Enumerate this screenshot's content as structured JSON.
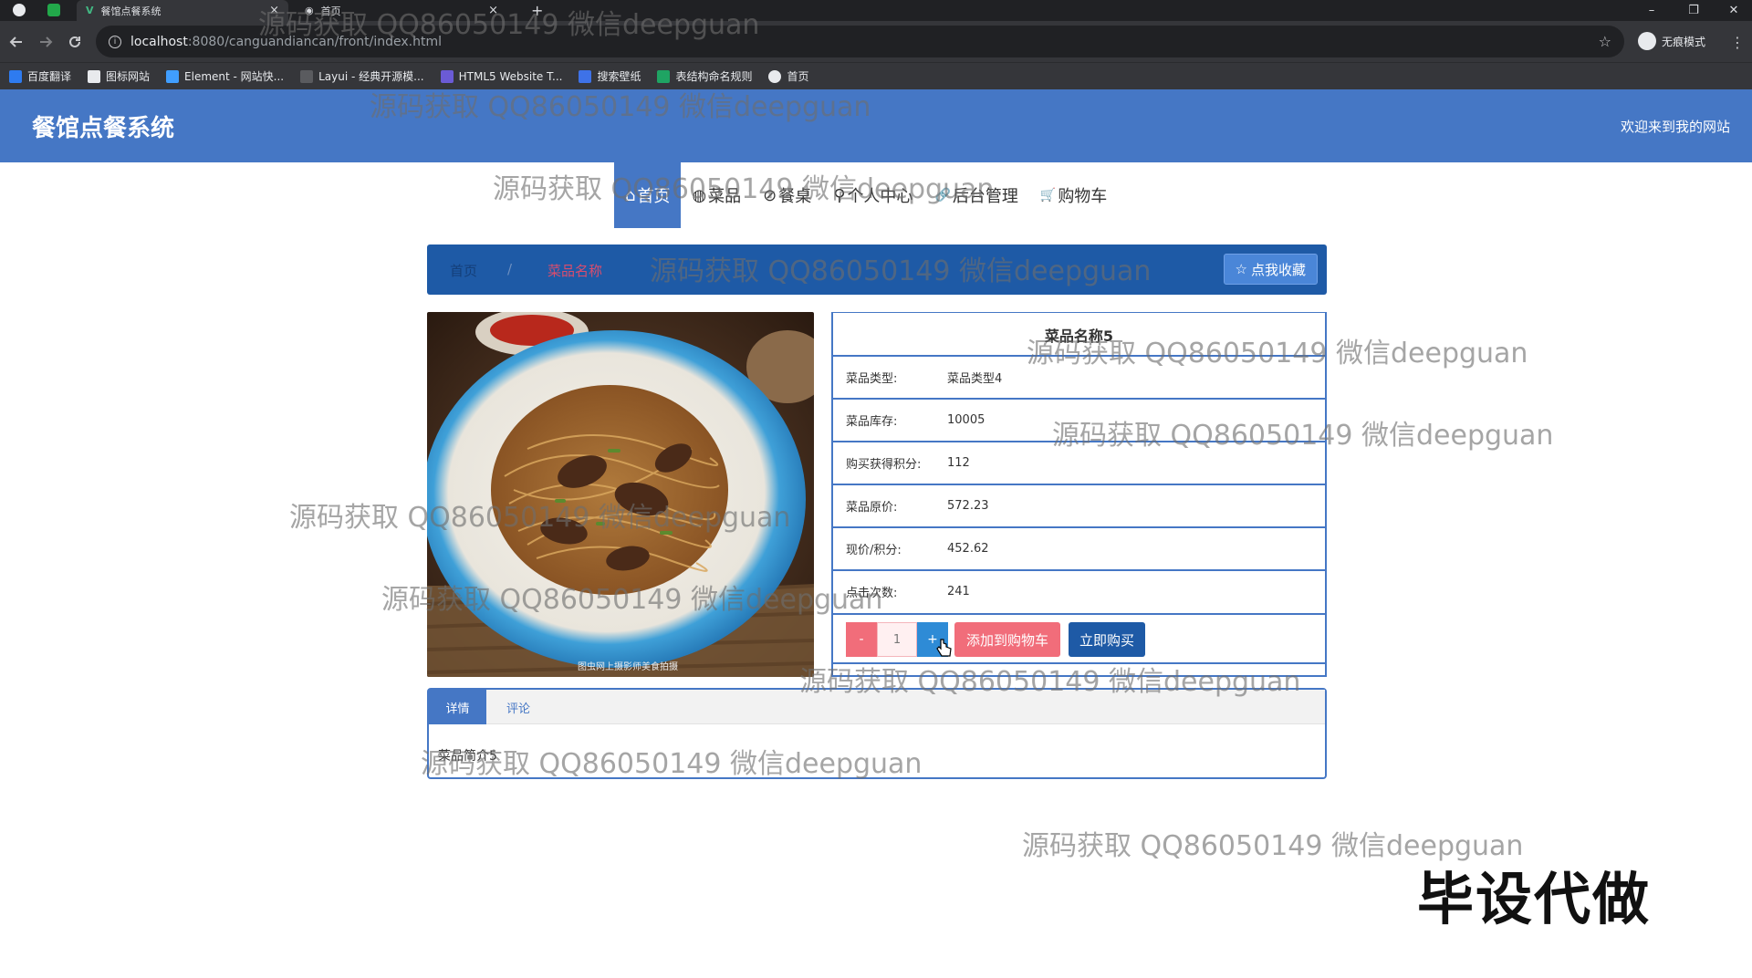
{
  "browser": {
    "tabs": [
      {
        "title": "餐馆点餐系统",
        "close": "×"
      },
      {
        "title": "首页",
        "close": "×"
      }
    ],
    "new_tab": "+",
    "window_controls": {
      "minimize": "–",
      "restore": "❐",
      "close": "✕"
    },
    "url_host": "localhost",
    "url_path": ":8080/canguandiancan/front/index.html",
    "profile_label": "无痕模式",
    "bookmarks": [
      "百度翻译",
      "图标网站",
      "Element - 网站快...",
      "Layui - 经典开源模...",
      "HTML5 Website T...",
      "搜索壁纸",
      "表结构命名规则",
      "首页"
    ],
    "icons": {
      "back": "arrow-left",
      "forward": "arrow-right",
      "reload": "reload",
      "star": "star",
      "menu": "kebab"
    }
  },
  "site": {
    "title": "餐馆点餐系统",
    "welcome": "欢迎来到我的网站",
    "accent_color": "#4577c5"
  },
  "nav": {
    "items": [
      {
        "label": "首页",
        "icon": "⌂",
        "active": true
      },
      {
        "label": "菜品",
        "icon": "◍",
        "active": false
      },
      {
        "label": "餐桌",
        "icon": "⊘",
        "active": false
      },
      {
        "label": "个人中心",
        "icon": "⚲",
        "active": false
      },
      {
        "label": "后台管理",
        "icon": "🔗",
        "active": false
      },
      {
        "label": "购物车",
        "icon": "🛒",
        "active": false
      }
    ]
  },
  "breadcrumb": {
    "home": "首页",
    "separator": "/",
    "current": "菜品名称",
    "favorite_button": "点我收藏",
    "favorite_icon": "☆"
  },
  "product": {
    "name": "菜品名称5",
    "rows": [
      {
        "label": "菜品类型:",
        "value": "菜品类型4"
      },
      {
        "label": "菜品库存:",
        "value": "10005"
      },
      {
        "label": "购买获得积分:",
        "value": "112"
      },
      {
        "label": "菜品原价:",
        "value": "572.23"
      },
      {
        "label": "现价/积分:",
        "value": "452.62"
      },
      {
        "label": "点击次数:",
        "value": "241"
      }
    ],
    "image_caption": "图虫网上摄影师美食拍摄",
    "quantity": "1",
    "minus": "-",
    "plus": "+",
    "add_to_cart": "添加到购物车",
    "buy_now": "立即购买"
  },
  "detail_tabs": {
    "tabs": [
      "详情",
      "评论"
    ],
    "content": "菜品简介5"
  },
  "overlay": {
    "watermark_text": "源码获取 QQ86050149 微信deepguan",
    "stamp_text": "毕设代做"
  }
}
